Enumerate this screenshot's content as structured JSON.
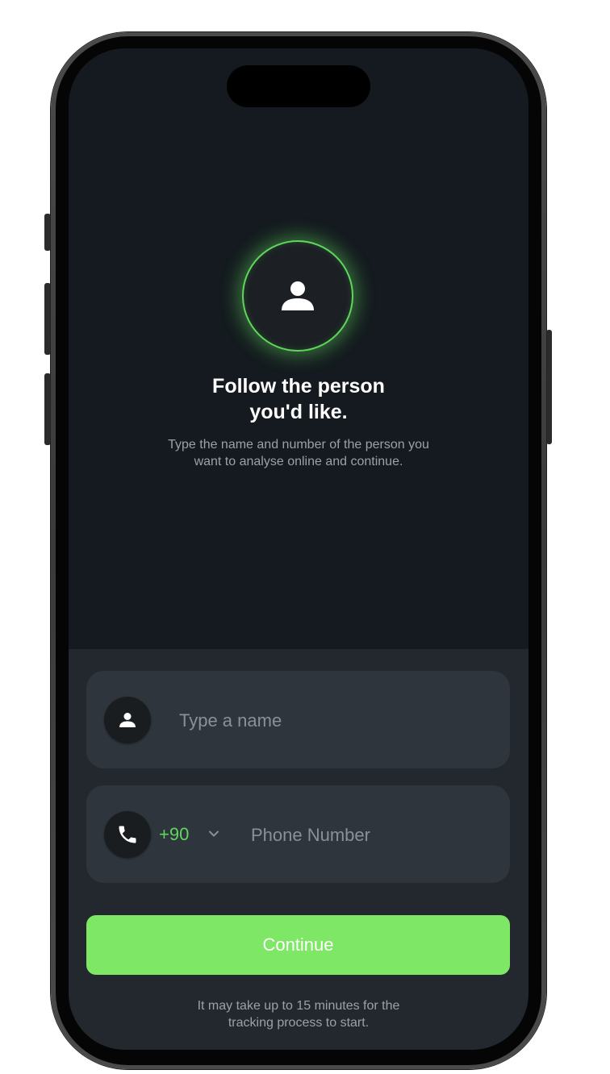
{
  "hero": {
    "title_line1": "Follow the person",
    "title_line2": "you'd like.",
    "subtitle_line1": "Type the name and number of the person you",
    "subtitle_line2": "want to analyse online and continue."
  },
  "form": {
    "name_placeholder": "Type a name",
    "name_value": "",
    "country_code": "+90",
    "phone_placeholder": "Phone Number",
    "phone_value": ""
  },
  "actions": {
    "continue_label": "Continue"
  },
  "footer": {
    "note_line1": "It may take up to 15 minutes for the",
    "note_line2": "tracking process to start."
  },
  "icons": {
    "avatar": "person-icon",
    "name_field": "person-icon",
    "phone_field": "phone-icon",
    "country_dropdown": "chevron-down-icon"
  },
  "colors": {
    "accent": "#5fd65c",
    "button": "#7ee765",
    "hero_background": "#141a1f",
    "form_background": "#22282e",
    "field_background": "#2e353c"
  }
}
